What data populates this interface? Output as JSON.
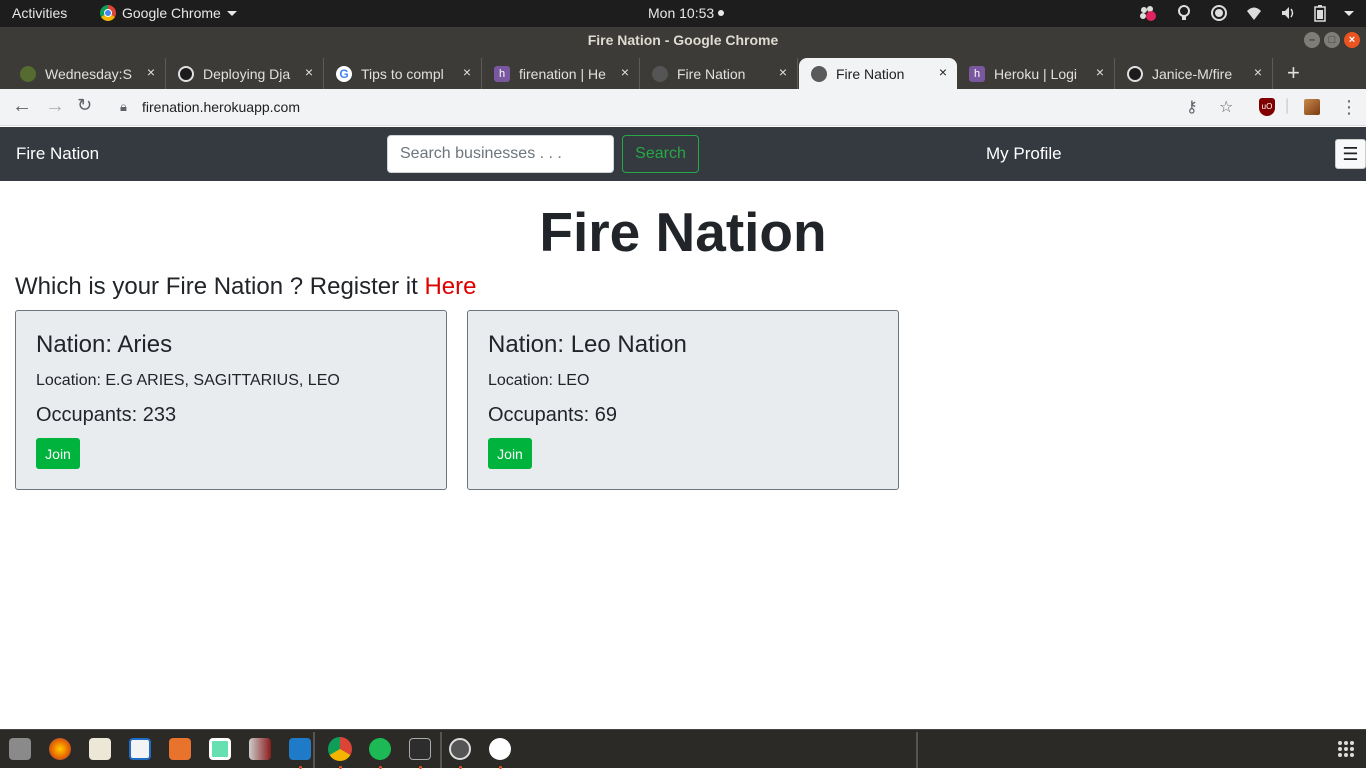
{
  "gnome": {
    "activities": "Activities",
    "app_name": "Google Chrome",
    "clock": "Mon 10:53"
  },
  "window": {
    "title": "Fire Nation - Google Chrome"
  },
  "tabs": [
    {
      "label": "Wednesday:S",
      "icon": "calendar-icon"
    },
    {
      "label": "Deploying Dja",
      "icon": "github-icon"
    },
    {
      "label": "Tips to compl",
      "icon": "google-icon"
    },
    {
      "label": "firenation | He",
      "icon": "heroku-icon"
    },
    {
      "label": "Fire Nation",
      "icon": "globe-icon"
    },
    {
      "label": "Fire Nation",
      "icon": "globe-icon",
      "active": true
    },
    {
      "label": "Heroku | Logi",
      "icon": "heroku-icon"
    },
    {
      "label": "Janice-M/fire",
      "icon": "github-icon"
    }
  ],
  "browser": {
    "url": "firenation.herokuapp.com"
  },
  "site": {
    "brand": "Fire Nation",
    "search_placeholder": "Search businesses . . .",
    "search_button": "Search",
    "profile_link": "My Profile",
    "heading": "Fire Nation",
    "tagline": "Which is your Fire Nation ? Register it",
    "tagline_link": "Here"
  },
  "cards": [
    {
      "title": "Nation: Aries",
      "location": "Location: E.G ARIES, SAGITTARIUS, LEO",
      "occupants": "Occupants: 233",
      "button": "Join"
    },
    {
      "title": "Nation: Leo Nation",
      "location": "Location: LEO",
      "occupants": "Occupants: 69",
      "button": "Join"
    }
  ],
  "colors": {
    "navbar": "#343a40",
    "search_outline": "#28a745",
    "link_red": "#e00000",
    "join_green": "#00b33c",
    "card_bg": "#e9ecef"
  }
}
